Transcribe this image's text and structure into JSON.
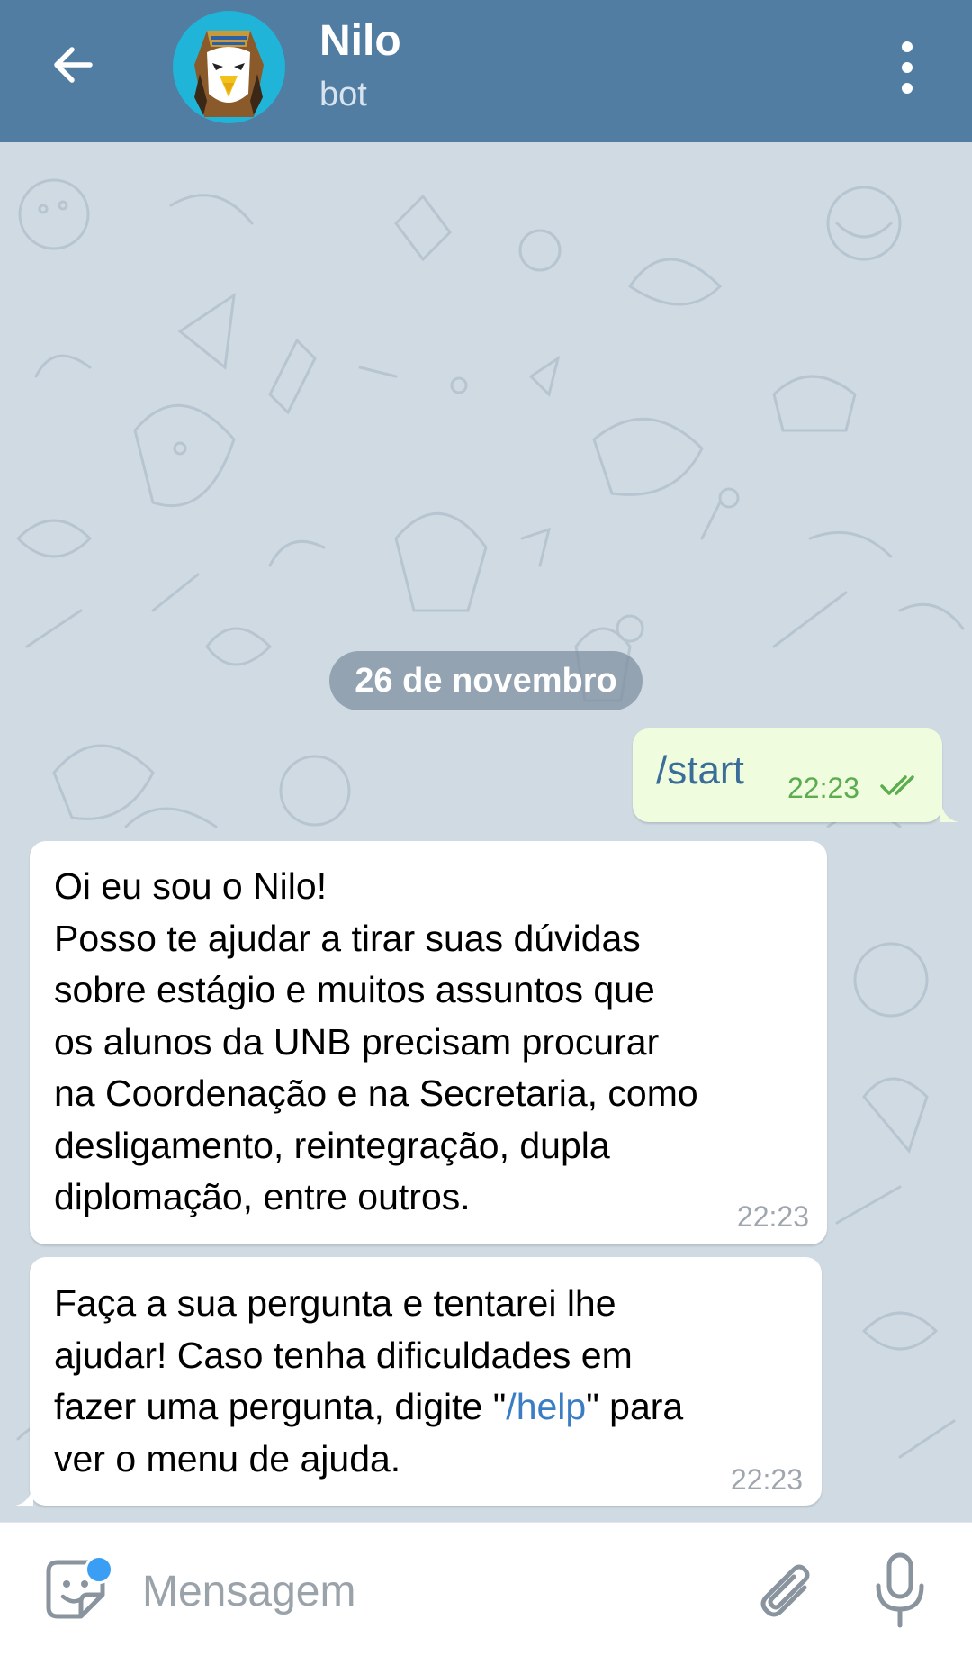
{
  "header": {
    "title": "Nilo",
    "subtitle": "bot",
    "colors": {
      "header_bg": "#517da2"
    },
    "icons": {
      "back": "arrow-left-icon",
      "more": "more-vertical-icon",
      "avatar": "pharaoh-eagle-avatar"
    }
  },
  "chat": {
    "date_label": "26 de novembro",
    "messages": [
      {
        "direction": "outgoing",
        "text": "/start",
        "time": "22:23",
        "status": "double-check-read"
      },
      {
        "direction": "incoming",
        "lines": [
          "Oi eu sou o Nilo!",
          "Posso te ajudar a tirar suas dúvidas",
          "sobre estágio e muitos assuntos que",
          "os alunos da UNB precisam procurar",
          "na Coordenação e na Secretaria, como",
          "desligamento, reintegração, dupla",
          "diplomação, entre outros."
        ],
        "time": "22:23"
      },
      {
        "direction": "incoming",
        "lines": [
          "Faça a sua pergunta e tentarei lhe",
          "ajudar! Caso tenha dificuldades em"
        ],
        "line3_before": "fazer uma pergunta, digite \"",
        "line3_link": "/help",
        "line3_after": "\" para",
        "line4": "ver o menu de ajuda.",
        "time": "22:23"
      }
    ],
    "colors": {
      "bg": "#cfdae3",
      "outgoing_bubble": "#effdde",
      "link": "#3a7dc4"
    }
  },
  "composer": {
    "placeholder": "Mensagem",
    "icons": {
      "sticker": "sticker-icon",
      "attach": "paperclip-icon",
      "mic": "microphone-icon"
    }
  }
}
